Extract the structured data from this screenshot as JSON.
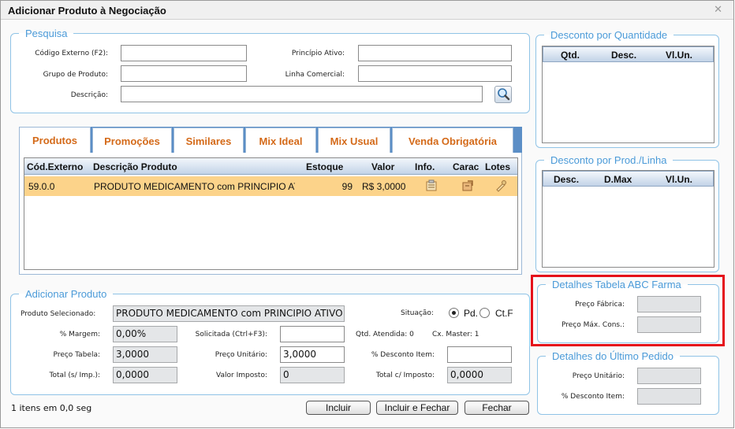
{
  "window": {
    "title": "Adicionar Produto à Negociação"
  },
  "pesquisa": {
    "legend": "Pesquisa",
    "codigo_externo_label": "Código Externo (F2):",
    "principio_ativo_label": "Princípio Ativo:",
    "grupo_produto_label": "Grupo de Produto:",
    "linha_comercial_label": "Linha Comercial:",
    "descricao_label": "Descrição:"
  },
  "tabs": [
    "Produtos",
    "Promoções",
    "Similares",
    "Mix Ideal",
    "Mix Usual",
    "Venda Obrigatória"
  ],
  "grid": {
    "headers": {
      "cod": "Cód.Externo",
      "desc": "Descrição Produto",
      "estoque": "Estoque",
      "valor": "Valor",
      "info": "Info.",
      "carac": "Carac",
      "lotes": "Lotes"
    },
    "row": {
      "cod": "59.0.0",
      "desc": "PRODUTO MEDICAMENTO com PRINCIPIO ATIVO",
      "estoque": "99",
      "valor": "R$ 3,0000"
    }
  },
  "adicionar": {
    "legend": "Adicionar Produto",
    "produto_selecionado_label": "Produto Selecionado:",
    "produto_selecionado_value": "PRODUTO MEDICAMENTO com PRINCIPIO ATIVO",
    "situacao_label": "Situação:",
    "pd_label": "Pd.",
    "ct_label": "Ct.F",
    "margem_label": "% Margem:",
    "margem_value": "0,00%",
    "solicitada_label": "Solicitada (Ctrl+F3):",
    "qtd_atendida_label": "Qtd. Atendida: 0",
    "cx_master_label": "Cx. Master: 1",
    "preco_tabela_label": "Preço Tabela:",
    "preco_tabela_value": "3,0000",
    "preco_unitario_label": "Preço Unitário:",
    "preco_unitario_value": "3,0000",
    "desconto_item_label": "% Desconto Item:",
    "total_s_imp_label": "Total (s/ Imp.):",
    "total_s_imp_value": "0,0000",
    "valor_imposto_label": "Valor Imposto:",
    "valor_imposto_value": "0",
    "total_c_imp_label": "Total c/ Imposto:",
    "total_c_imp_value": "0,0000"
  },
  "desconto_qtd": {
    "legend": "Desconto por Quantidade",
    "headers": [
      "Qtd.",
      "Desc.",
      "Vl.Un."
    ]
  },
  "desconto_prod": {
    "legend": "Desconto por Prod./Linha",
    "headers": [
      "Desc.",
      "D.Max",
      "Vl.Un."
    ]
  },
  "abc": {
    "legend": "Detalhes Tabela ABC Farma",
    "preco_fabrica_label": "Preço Fábrica:",
    "preco_max_label": "Preço Máx. Cons.:"
  },
  "ultimo": {
    "legend": "Detalhes do Último Pedido",
    "preco_unitario_label": "Preço Unitário:",
    "desconto_item_label": "% Desconto Item:"
  },
  "footer": {
    "status": "1 itens em 0,0 seg",
    "incluir": "Incluir",
    "incluir_fechar": "Incluir e Fechar",
    "fechar": "Fechar"
  },
  "colors": {
    "accent": "#4a9ad8",
    "tab_text": "#d46a19",
    "selected_row": "#fcd38a",
    "highlight_border": "#e5101a",
    "tab_strip": "#5b8ec6"
  }
}
